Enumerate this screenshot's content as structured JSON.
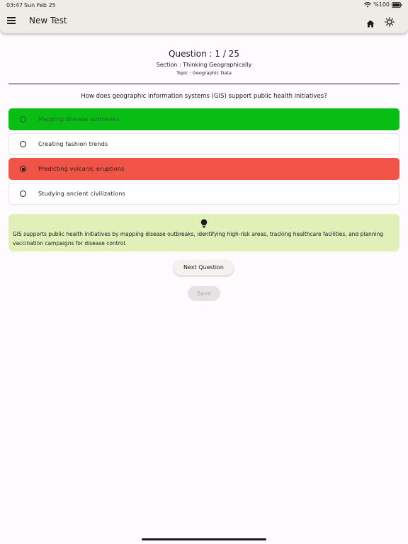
{
  "status_bar": {
    "time": "03:47",
    "date": "Sun Feb 25",
    "battery": "%100"
  },
  "app_bar": {
    "title": "New Test",
    "icons": [
      "menu-icon",
      "home-icon",
      "brightness-icon"
    ]
  },
  "header": {
    "question_counter": "Question : 1 / 25",
    "section": "Section : Thinking Geographically",
    "topic": "Topic : Geographic Data"
  },
  "question": "How does geographic information systems (GIS) support public health initiatives?",
  "options": [
    {
      "label": "Mapping disease outbreaks",
      "state": "correct",
      "selected": false
    },
    {
      "label": "Creating fashion trends",
      "state": "neutral",
      "selected": false
    },
    {
      "label": "Predicting volcanic eruptions",
      "state": "wrong",
      "selected": true
    },
    {
      "label": "Studying ancient civilizations",
      "state": "neutral",
      "selected": false
    }
  ],
  "explanation": {
    "icon": "lightbulb-icon",
    "text": "GIS supports public health initiatives by mapping disease outbreaks, identifying high-risk areas, tracking healthcare facilities, and planning vaccination campaigns for disease control."
  },
  "buttons": {
    "next_label": "Next Question",
    "save_label": "Save"
  },
  "colors": {
    "correct": "#08bd13",
    "wrong": "#ef5447",
    "explanation_bg": "#e1f0b8",
    "app_bar_bg": "#efece7"
  }
}
